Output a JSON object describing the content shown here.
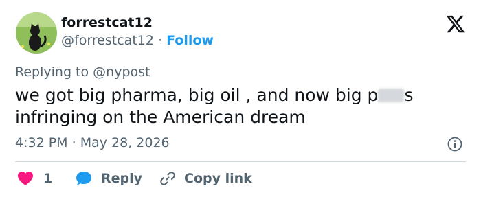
{
  "author": {
    "name": "forrestcat12",
    "handle": "@forrestcat12",
    "separator": "·",
    "follow_label": "Follow"
  },
  "reply": {
    "prefix": "Replying to",
    "target": "@nypost"
  },
  "tweet": {
    "line1_before": "we got big pharma, big oil , and now big p",
    "line1_after": "s",
    "line2": "infringing on the American dream"
  },
  "meta": {
    "time": "4:32 PM",
    "separator": "·",
    "date": "May 28, 2026"
  },
  "actions": {
    "like_count": "1",
    "reply_label": "Reply",
    "copy_label": "Copy link"
  },
  "colors": {
    "accent": "#1d9bf0",
    "like": "#f91880",
    "muted": "#536471",
    "text": "#0f1419"
  },
  "icons": [
    "x-logo-icon",
    "info-icon",
    "heart-icon",
    "speech-bubble-icon",
    "link-icon"
  ]
}
